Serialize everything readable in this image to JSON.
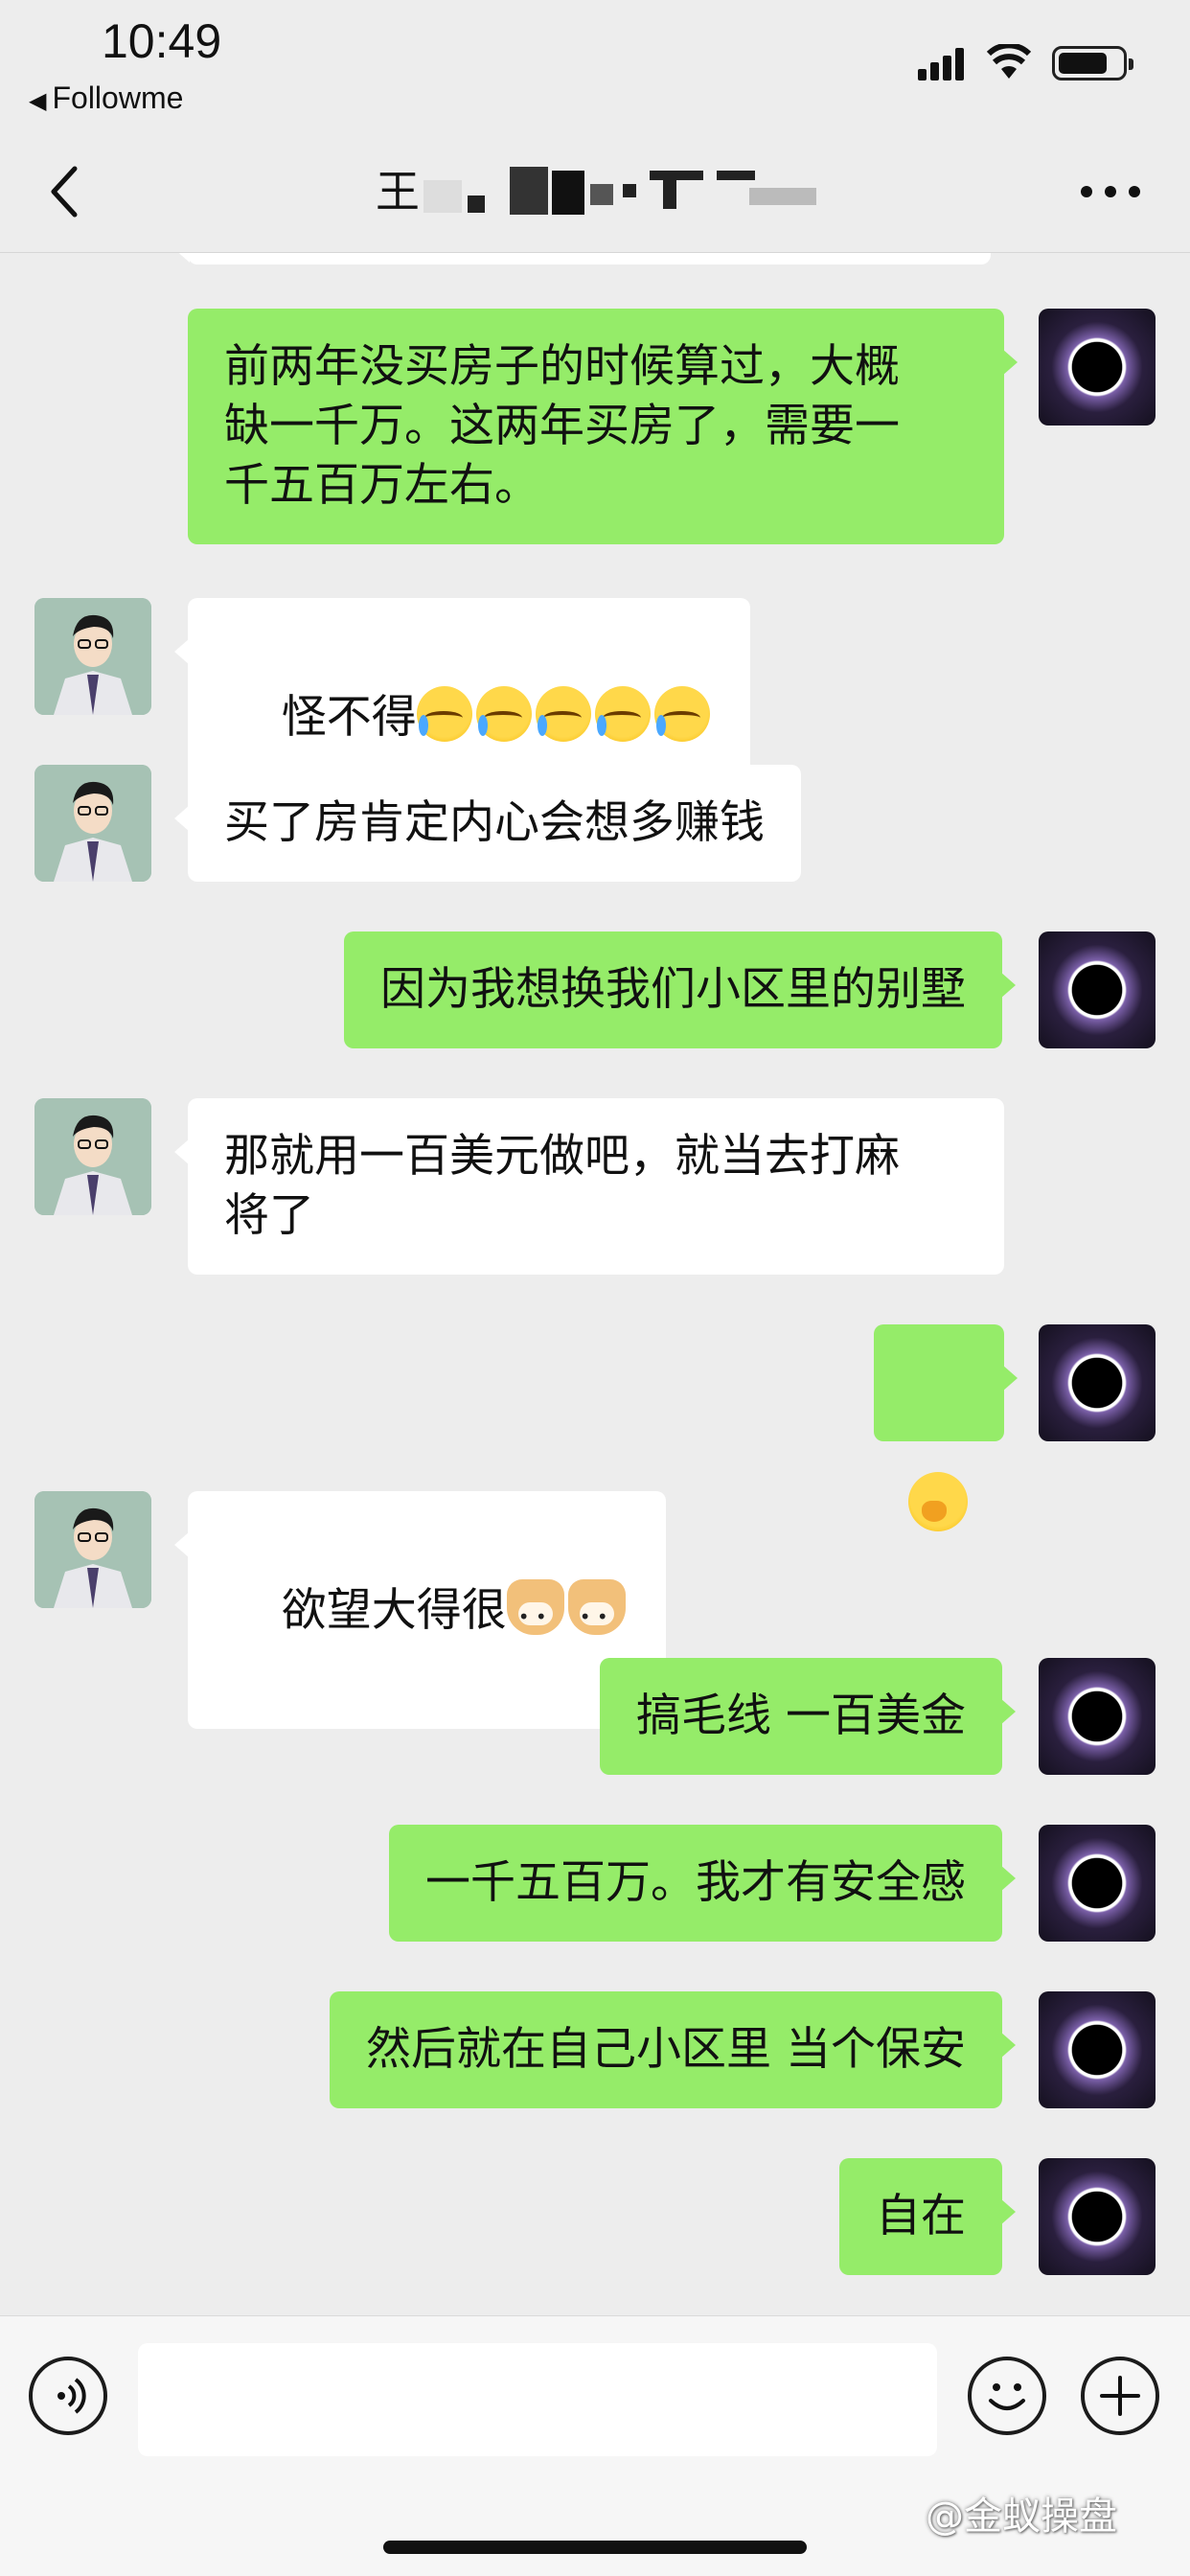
{
  "status_bar": {
    "time": "10:49",
    "back_app": "Followme"
  },
  "nav": {
    "title_visible_char": "王",
    "back_icon": "chevron-left-icon",
    "more_icon": "more-dots-icon"
  },
  "messages": [
    {
      "side": "right",
      "text": "前两年没买房子的时候算过，大概\n缺一千万。这两年买房了，需要一\n千五百万左右。"
    },
    {
      "side": "left",
      "text": "怪不得",
      "emoji": "cry",
      "emoji_count": 5
    },
    {
      "side": "left",
      "text": "买了房肯定内心会想多赚钱"
    },
    {
      "side": "right",
      "text": "因为我想换我们小区里的别墅"
    },
    {
      "side": "left",
      "text": "那就用一百美元做吧，就当去打麻\n将了"
    },
    {
      "side": "right",
      "text": "",
      "emoji": "shy",
      "emoji_count": 1
    },
    {
      "side": "left",
      "text": "欲望大得很",
      "emoji": "dog",
      "emoji_count": 2
    },
    {
      "side": "right",
      "text": "搞毛线 一百美金"
    },
    {
      "side": "right",
      "text": "一千五百万。我才有安全感"
    },
    {
      "side": "right",
      "text": "然后就在自己小区里 当个保安"
    },
    {
      "side": "right",
      "text": "自在"
    }
  ],
  "input_bar": {
    "voice_icon": "voice-icon",
    "emoji_icon": "emoji-icon",
    "plus_icon": "plus-icon",
    "placeholder": ""
  },
  "watermark": "@金蚁操盘",
  "colors": {
    "background": "#ededed",
    "my_bubble": "#95ec69",
    "their_bubble": "#ffffff"
  }
}
